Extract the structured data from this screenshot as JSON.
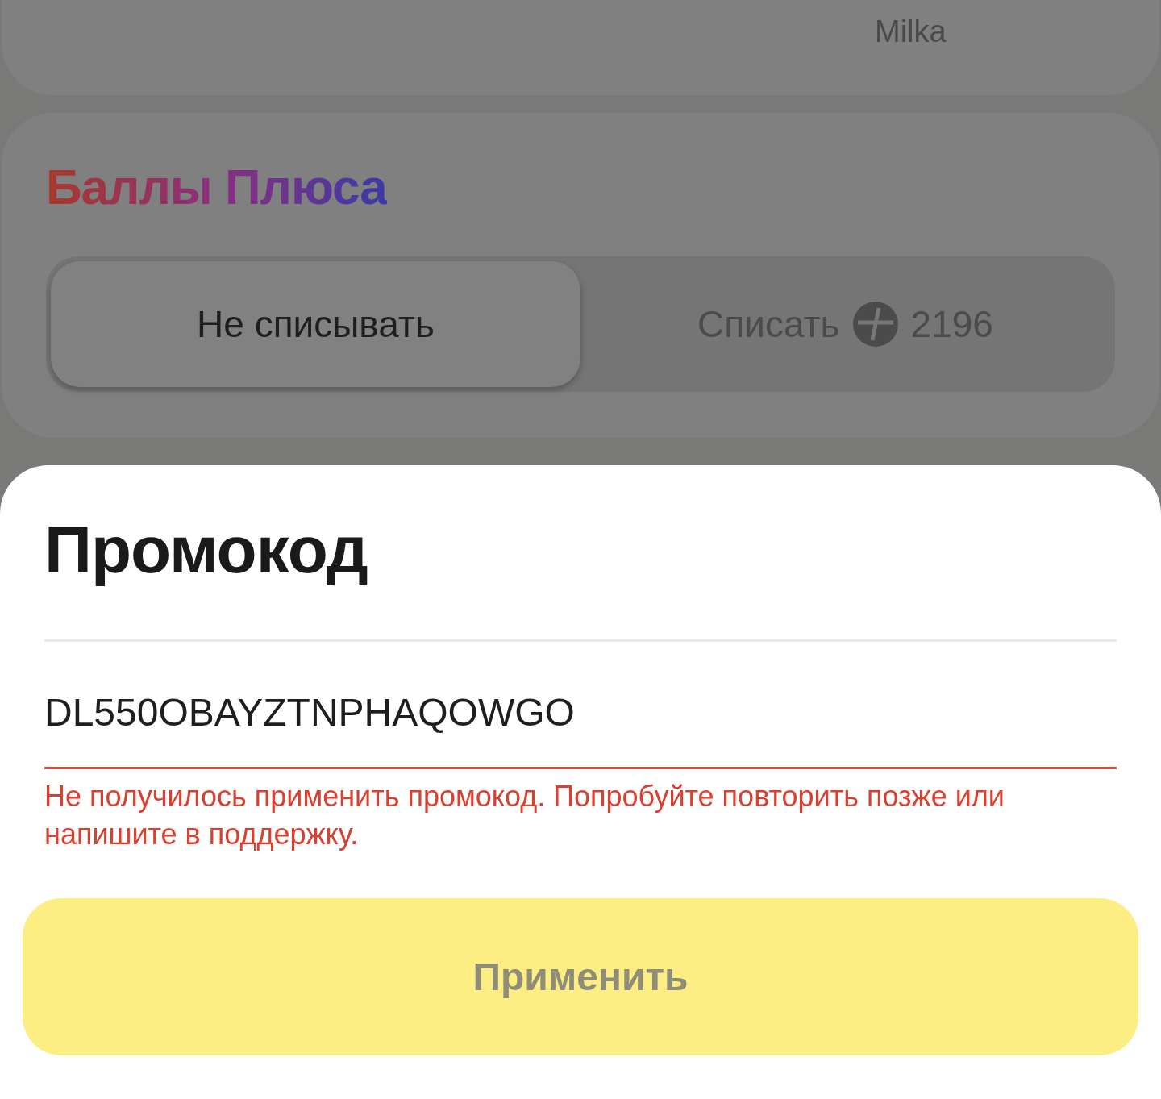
{
  "products_card": {
    "items": [
      "Milka"
    ]
  },
  "plus_points": {
    "title": "Баллы Плюса",
    "options": [
      {
        "label": "Не списывать",
        "selected": true
      },
      {
        "label": "Списать",
        "amount": "2196",
        "selected": false
      }
    ]
  },
  "promo_sheet": {
    "title": "Промокод",
    "field": {
      "value": "DL550OBAYZTNPHAQOWGO",
      "invalid": true
    },
    "error": "Не получилось применить промокод. Попробуйте повторить позже или напишите в поддержку.",
    "button": {
      "label": "Применить",
      "disabled": true
    }
  }
}
